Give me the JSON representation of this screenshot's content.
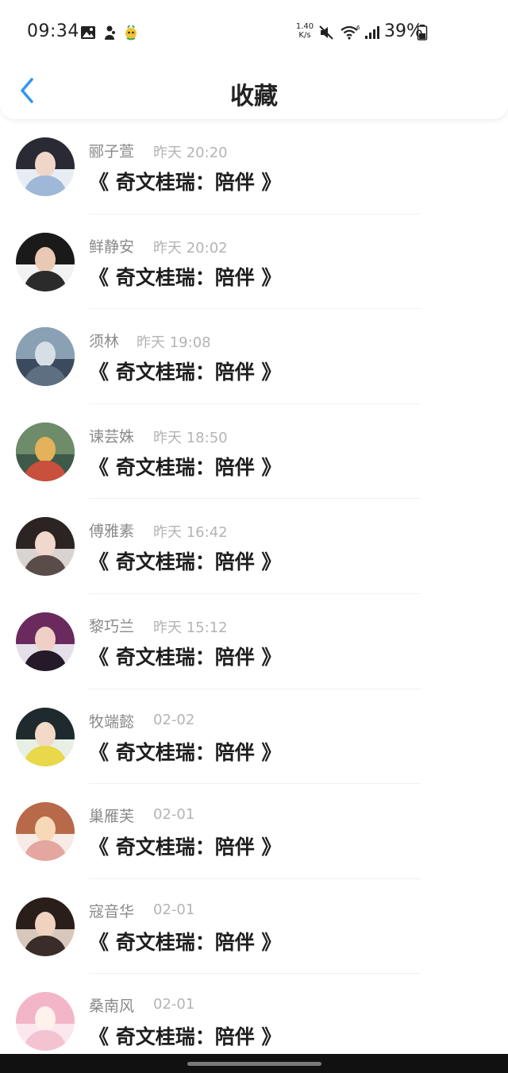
{
  "status_bar": {
    "time": "09:34",
    "speed_value": "1.40",
    "speed_unit": "K/s",
    "battery": "39%",
    "icons": [
      "gallery-icon",
      "app-icon",
      "bird-app-icon",
      "mute-icon",
      "wifi-6-icon",
      "signal-icon",
      "battery-icon"
    ]
  },
  "header": {
    "title": "收藏",
    "back_icon": "chevron-left-icon",
    "accent": "#2f97f2"
  },
  "favorites": [
    {
      "name": "郦子萱",
      "time": "昨天 20:20",
      "title": "《 奇文桂瑞：陪伴 》",
      "avatar": "avatar-1"
    },
    {
      "name": "鲜静安",
      "time": "昨天 20:02",
      "title": "《 奇文桂瑞：陪伴 》",
      "avatar": "avatar-2"
    },
    {
      "name": "须林",
      "time": "昨天 19:08",
      "title": "《 奇文桂瑞：陪伴 》",
      "avatar": "avatar-3"
    },
    {
      "name": "谏芸姝",
      "time": "昨天 18:50",
      "title": "《 奇文桂瑞：陪伴 》",
      "avatar": "avatar-4"
    },
    {
      "name": "傅雅素",
      "time": "昨天 16:42",
      "title": "《 奇文桂瑞：陪伴 》",
      "avatar": "avatar-5"
    },
    {
      "name": "黎巧兰",
      "time": "昨天 15:12",
      "title": "《 奇文桂瑞：陪伴 》",
      "avatar": "avatar-6"
    },
    {
      "name": "牧端懿",
      "time": "02-02",
      "title": "《 奇文桂瑞：陪伴 》",
      "avatar": "avatar-7"
    },
    {
      "name": "巢雁芙",
      "time": "02-01",
      "title": "《 奇文桂瑞：陪伴 》",
      "avatar": "avatar-8"
    },
    {
      "name": "寇音华",
      "time": "02-01",
      "title": "《 奇文桂瑞：陪伴 》",
      "avatar": "avatar-9"
    },
    {
      "name": "桑南风",
      "time": "02-01",
      "title": "《 奇文桂瑞：陪伴 》",
      "avatar": "avatar-10"
    }
  ],
  "colors": {
    "name": "#8a8a8a",
    "time": "#b4b4b4",
    "title": "#1e1e1e",
    "divider": "#f0f0f0"
  }
}
